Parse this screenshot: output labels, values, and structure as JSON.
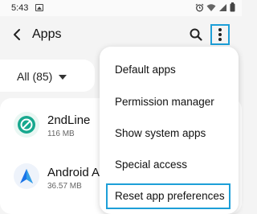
{
  "status_bar": {
    "time": "5:43",
    "icons": [
      "image-icon",
      "alarm-icon",
      "wifi-icon",
      "signal-icon",
      "battery-icon"
    ]
  },
  "app_bar": {
    "title": "Apps",
    "back_icon": "back-arrow-icon",
    "search_icon": "search-icon",
    "more_icon": "more-options-icon",
    "highlight_color": "#1d9fd8"
  },
  "filter": {
    "label": "All (85)"
  },
  "apps": [
    {
      "name": "2ndLine",
      "size": "116 MB",
      "icon": "2ndline-app-icon",
      "color": "#17a88e"
    },
    {
      "name": "Android Auto",
      "size": "36.57 MB",
      "icon": "android-auto-app-icon",
      "color": "#1a73e8"
    }
  ],
  "menu": {
    "items": [
      {
        "label": "Default apps"
      },
      {
        "label": "Permission manager"
      },
      {
        "label": "Show system apps"
      },
      {
        "label": "Special access"
      },
      {
        "label": "Reset app preferences",
        "highlighted": true
      }
    ]
  }
}
